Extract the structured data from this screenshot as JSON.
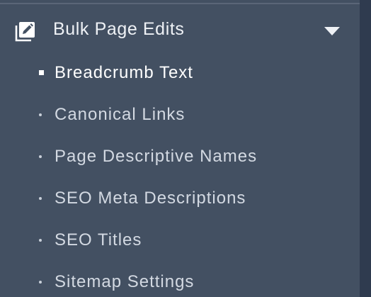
{
  "section": {
    "title": "Bulk Page Edits",
    "icon": "edit-square-icon",
    "expanded": true
  },
  "items": [
    {
      "label": "Breadcrumb Text",
      "active": true
    },
    {
      "label": "Canonical Links",
      "active": false
    },
    {
      "label": "Page Descriptive Names",
      "active": false
    },
    {
      "label": "SEO Meta Descriptions",
      "active": false
    },
    {
      "label": "SEO Titles",
      "active": false
    },
    {
      "label": "Sitemap Settings",
      "active": false
    }
  ],
  "colors": {
    "panel_bg": "#435062",
    "page_bg": "#2f3b4f",
    "text": "#d3d9e2",
    "active_text": "#ffffff"
  }
}
